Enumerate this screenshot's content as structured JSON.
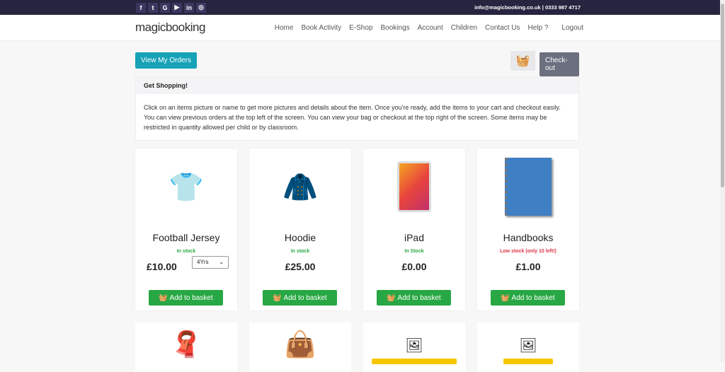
{
  "topbar": {
    "social": [
      "f",
      "t",
      "G",
      "▶",
      "in",
      "◎"
    ],
    "contact": "info@magicbooking.co.uk | 0333 987 4717"
  },
  "header": {
    "logo": "magicbooking",
    "nav": [
      "Home",
      "Book Activity",
      "E-Shop",
      "Bookings",
      "Account",
      "Children",
      "Contact Us",
      "Help ?",
      "Logout"
    ]
  },
  "actions": {
    "view_orders": "View My Orders",
    "checkout": "Check-out"
  },
  "info": {
    "title": "Get Shopping!",
    "body": "Click on an items picture or name to get more pictures and details about the item. Once you're ready, add the items to your cart and checkout easily. You can view previous orders at the top left of the screen. You can view your bag or checkout at the top right of the screen. Some items may be restricted in quantity allowed per child or by classroom."
  },
  "products": [
    {
      "name": "Football Jersey",
      "stock": "In stock",
      "price": "£10.00",
      "size": "4Yrs",
      "button": "Add to basket",
      "stock_color": "#28a745"
    },
    {
      "name": "Hoodie",
      "stock": "In stock",
      "price": "£25.00",
      "button": "Add to basket",
      "stock_color": "#28a745"
    },
    {
      "name": "iPad",
      "stock": "In Stock",
      "price": "£0.00",
      "button": "Add to basket",
      "stock_color": "#28a745"
    },
    {
      "name": "Handbooks",
      "stock": "Low stock (only 10 left!)",
      "price": "£1.00",
      "button": "Add to basket",
      "stock_color": "#dc3545"
    }
  ]
}
